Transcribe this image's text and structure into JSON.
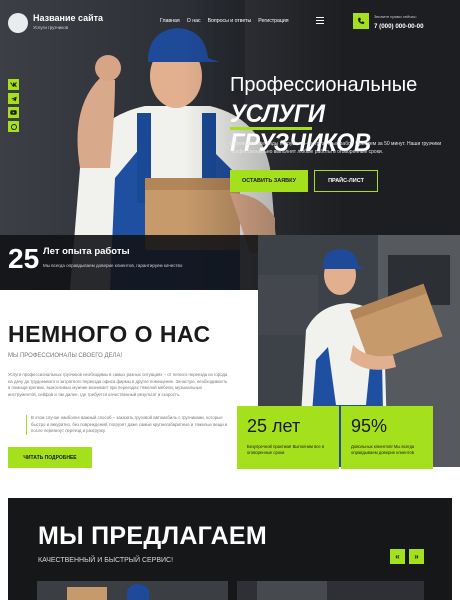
{
  "header": {
    "site_name": "Название сайта",
    "site_subtitle": "Услуги грузчиков",
    "nav": [
      "Главная",
      "О нас",
      "Вопросы и ответы",
      "Регистрация"
    ],
    "phone_caption": "Звоните прямо сейчас:",
    "phone_number": "7 (000) 000-00-00"
  },
  "social": [
    "vk-icon",
    "telegram-icon",
    "youtube-icon",
    "whatsapp-icon"
  ],
  "hero": {
    "title_line1": "Профессиональные",
    "title_line2": "УСЛУГИ ГРУЗЧИКОВ",
    "text": "Перевозим все виды погрузочно-разгрузочных работ. Приедем за 50 минут. Наши грузчики профессионально выполнят любые работы в оговоренные сроки.",
    "btn_order": "ОСТАВИТЬ ЗАЯВКУ",
    "btn_price": "ПРАЙС-ЛИСТ"
  },
  "experience": {
    "number": "25",
    "title": "Лет опыта работы",
    "subtitle": "Мы всегда оправдываем доверие клиентов, гарантируем качество"
  },
  "about": {
    "title": "НЕМНОГО О НАС",
    "subtitle": "МЫ ПРОФЕССИОНАЛЫ СВОЕГО ДЕЛА!",
    "p1": "Услуги профессиональных грузчиков необходимы в самых разных ситуациях – от легкого переезда из города на дачу до трудоемкого и затратного переезда офиса фирмы в другое помещение. Зачастую, необходимость в помощи крепких, выносливых мужчин возникает при переездах тяжелой мебели, музыкальных инструментов, сейфов и так далее, где требуется качественный результат и скорость.",
    "p2": "В этом случае наиболее важный способ – заказать грузовой автомобиль с грузчиками, которые быстро и аккуратно, без повреждений, погрузят даже самые крупногабаритные и тяжелые вещи и после перевезут переезд и разгрузку.",
    "btn_more": "ЧИТАТЬ ПОДРОБНЕЕ"
  },
  "stats": [
    {
      "value": "25 лет",
      "text": "Безупречной практики! Выполним все в оговоренные сроки"
    },
    {
      "value": "95%",
      "text": "Довольных клиентов! Мы всегда оправдываем доверие клиентов"
    }
  ],
  "offer": {
    "title": "МЫ ПРЕДЛАГАЕМ",
    "subtitle": "КАЧЕСТВЕННЫЙ И БЫСТРЫЙ СЕРВИС!",
    "prev": "«",
    "next": "»"
  },
  "colors": {
    "accent": "#a4e01c",
    "dark": "#151719"
  }
}
